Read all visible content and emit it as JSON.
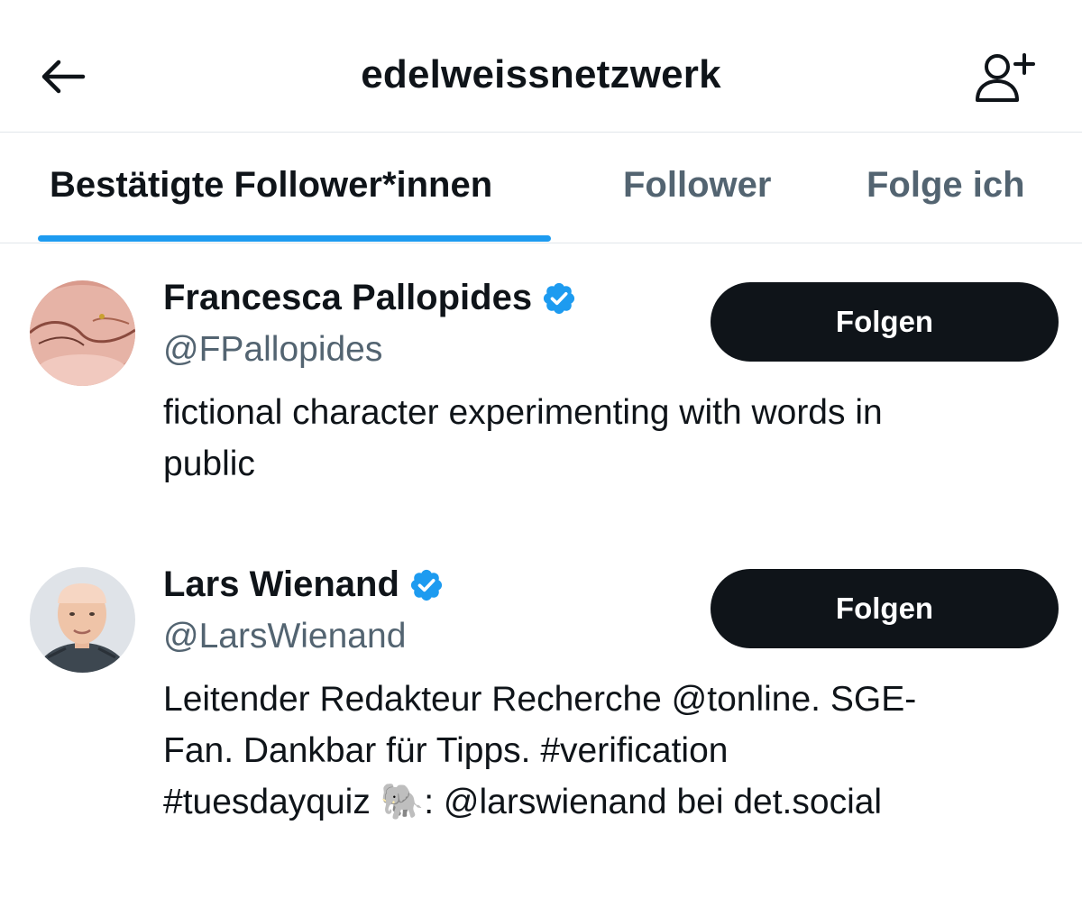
{
  "header": {
    "title": "edelweissnetzwerk",
    "back_icon": "arrow-left-icon",
    "add_user_icon": "person-plus-icon"
  },
  "tabs": [
    {
      "label": "Bestätigte Follower*innen",
      "active": true
    },
    {
      "label": "Follower",
      "active": false
    },
    {
      "label": "Folge ich",
      "active": false
    }
  ],
  "colors": {
    "accent": "#1d9bf0",
    "text_primary": "#0f1419",
    "text_secondary": "#536471",
    "button_bg": "#0f1419",
    "verified_badge": "#1d9bf0"
  },
  "users": [
    {
      "name": "Francesca Pallopides",
      "handle": "@FPallopides",
      "verified": true,
      "bio_lines": [
        "fictional character experimenting with words in",
        "public"
      ],
      "follow_label": "Folgen"
    },
    {
      "name": "Lars Wienand",
      "handle": "@LarsWienand",
      "verified": true,
      "bio_lines": [
        "Leitender Redakteur Recherche @tonline. SGE-",
        "Fan. Dankbar für Tipps. #verification",
        "#tuesdayquiz 🐘: @larswienand bei det.social"
      ],
      "follow_label": "Folgen"
    }
  ]
}
